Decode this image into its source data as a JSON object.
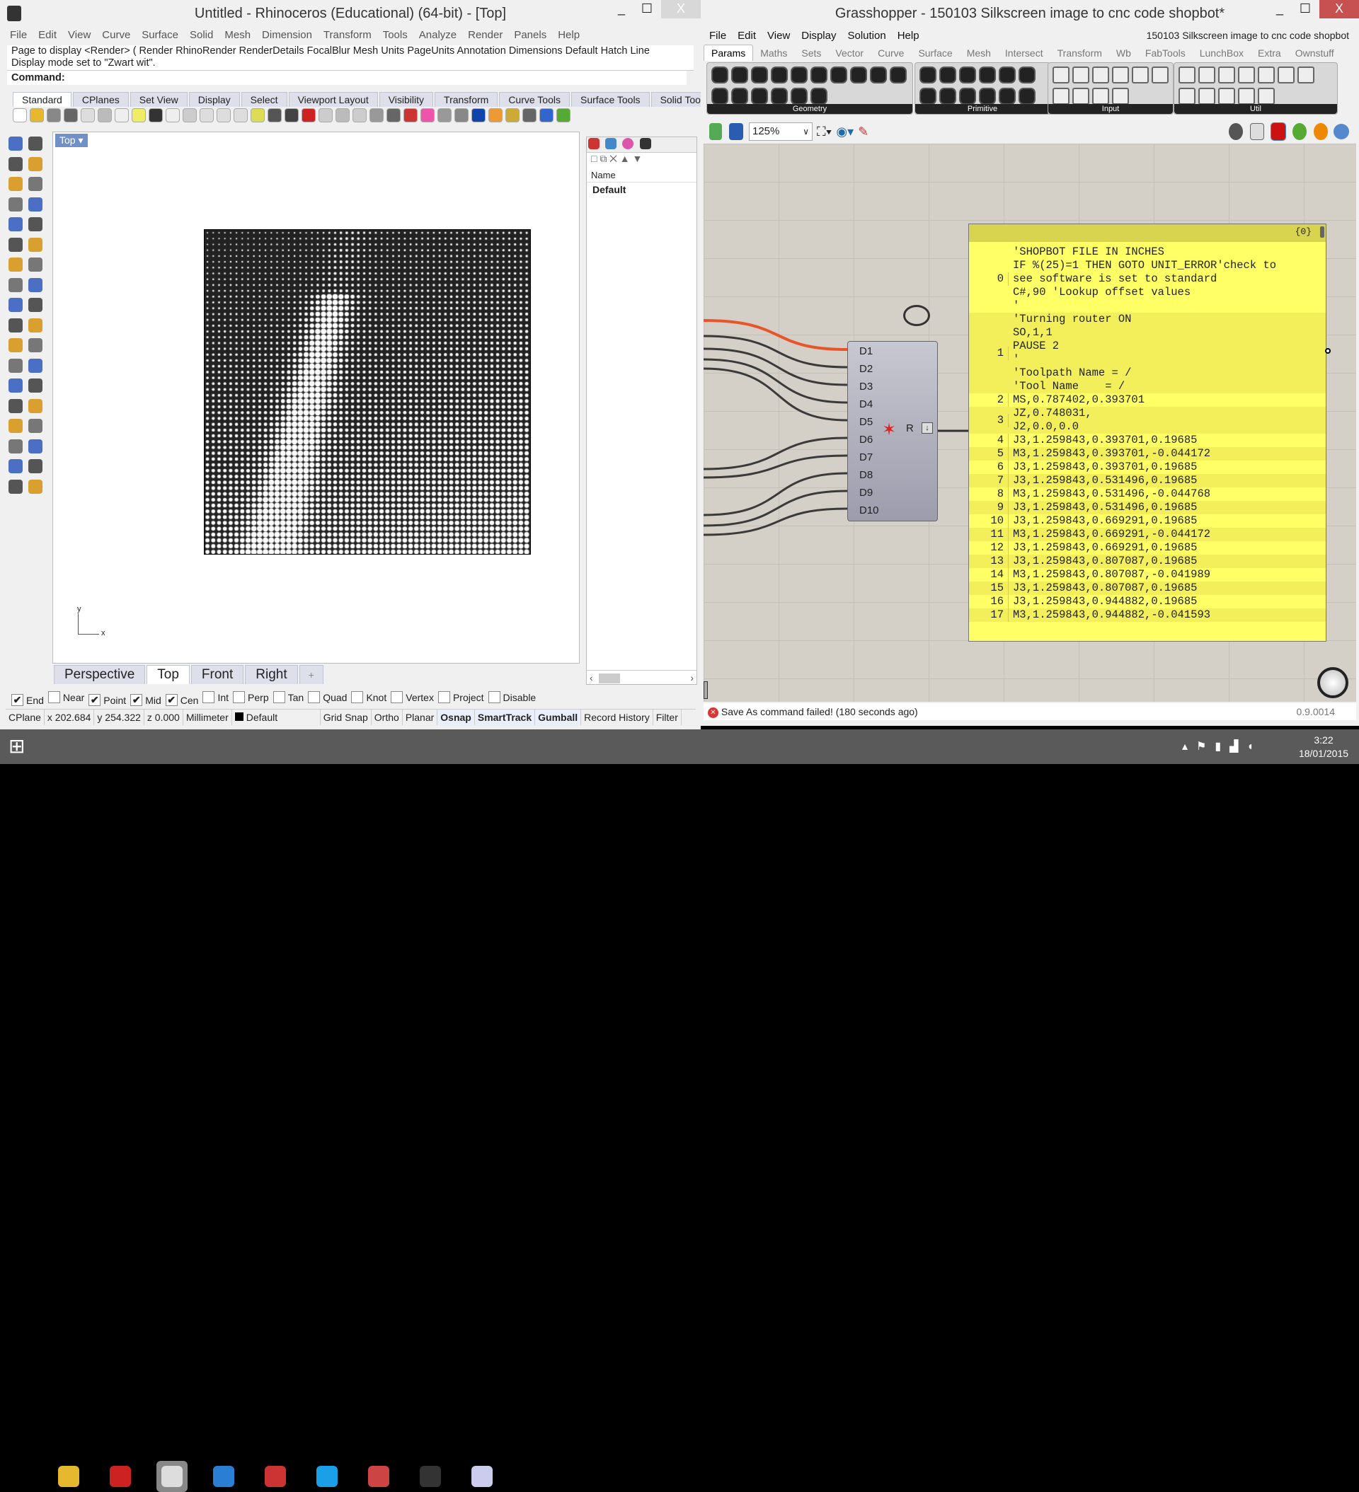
{
  "rhino": {
    "title": "Untitled - Rhinoceros (Educational) (64-bit) - [Top]",
    "window_controls": {
      "minimize": "_",
      "maximize": "☐",
      "close": "X"
    },
    "menu": [
      "File",
      "Edit",
      "View",
      "Curve",
      "Surface",
      "Solid",
      "Mesh",
      "Dimension",
      "Transform",
      "Tools",
      "Analyze",
      "Render",
      "Panels",
      "Help"
    ],
    "history": [
      "Page to display <Render> ( Render  RhinoRender  RenderDetails  FocalBlur  Mesh  Units  PageUnits  Annotation  Dimensions  Default  Hatch  Line",
      "Display mode set to \"Zwart wit\"."
    ],
    "command_label": "Command:",
    "toolbar_tabs": [
      "Standard",
      "CPlanes",
      "Set View",
      "Display",
      "Select",
      "Viewport Layout",
      "Visibility",
      "Transform",
      "Curve Tools",
      "Surface Tools",
      "Solid Tools"
    ],
    "toolbar_more": "»",
    "viewport": {
      "label": "Top",
      "axis_x": "x",
      "axis_y": "y"
    },
    "viewport_tabs": [
      "Perspective",
      "Top",
      "Front",
      "Right"
    ],
    "viewport_tab_add": "+",
    "active_viewport_tab": "Top",
    "layers": {
      "header": "Name",
      "items": [
        "Default"
      ]
    },
    "osnaps": [
      {
        "label": "End",
        "checked": true
      },
      {
        "label": "Near",
        "checked": false
      },
      {
        "label": "Point",
        "checked": true
      },
      {
        "label": "Mid",
        "checked": true
      },
      {
        "label": "Cen",
        "checked": true
      },
      {
        "label": "Int",
        "checked": false
      },
      {
        "label": "Perp",
        "checked": false
      },
      {
        "label": "Tan",
        "checked": false
      },
      {
        "label": "Quad",
        "checked": false
      },
      {
        "label": "Knot",
        "checked": false
      },
      {
        "label": "Vertex",
        "checked": false
      },
      {
        "label": "Project",
        "checked": false
      },
      {
        "label": "Disable",
        "checked": false
      }
    ],
    "status": {
      "cplane": "CPlane",
      "x": "x 202.684",
      "y": "y 254.322",
      "z": "z 0.000",
      "units": "Millimeter",
      "layer": "Default",
      "toggles": [
        {
          "label": "Grid Snap",
          "on": false
        },
        {
          "label": "Ortho",
          "on": false
        },
        {
          "label": "Planar",
          "on": false
        },
        {
          "label": "Osnap",
          "on": true
        },
        {
          "label": "SmartTrack",
          "on": true
        },
        {
          "label": "Gumball",
          "on": true
        },
        {
          "label": "Record History",
          "on": false
        },
        {
          "label": "Filter",
          "on": false
        }
      ]
    }
  },
  "grasshopper": {
    "title": "Grasshopper - 150103 Silkscreen image to cnc code shopbot*",
    "window_controls": {
      "minimize": "_",
      "maximize": "☐",
      "close": "X"
    },
    "menu": [
      "File",
      "Edit",
      "View",
      "Display",
      "Solution",
      "Help"
    ],
    "document_name": "150103 Silkscreen image to cnc code shopbot",
    "tabs": [
      "Params",
      "Maths",
      "Sets",
      "Vector",
      "Curve",
      "Surface",
      "Mesh",
      "Intersect",
      "Transform",
      "Wb",
      "FabTools",
      "LunchBox",
      "Extra",
      "Ownstuff"
    ],
    "active_tab": "Params",
    "ribbon_groups": [
      "Geometry",
      "Primitive",
      "Input",
      "Util"
    ],
    "zoom": "125%",
    "component": {
      "inputs": [
        "D1",
        "D2",
        "D3",
        "D4",
        "D5",
        "D6",
        "D7",
        "D8",
        "D9",
        "D10"
      ],
      "output": "R"
    },
    "panel": {
      "path": "{0}",
      "rows": [
        {
          "index": "0",
          "text": "'SHOPBOT FILE IN INCHES\nIF %(25)=1 THEN GOTO UNIT_ERROR'check to\nsee software is set to standard\nC#,90 'Lookup offset values\n'"
        },
        {
          "index": "1",
          "text": "'Turning router ON\nSO,1,1\nPAUSE 2\n'\n'Toolpath Name = /\n'Tool Name    = /"
        },
        {
          "index": "2",
          "text": "MS,0.787402,0.393701"
        },
        {
          "index": "3",
          "text": "JZ,0.748031,\nJ2,0.0,0.0"
        },
        {
          "index": "4",
          "text": "J3,1.259843,0.393701,0.19685"
        },
        {
          "index": "5",
          "text": "M3,1.259843,0.393701,-0.044172"
        },
        {
          "index": "6",
          "text": "J3,1.259843,0.393701,0.19685"
        },
        {
          "index": "7",
          "text": "J3,1.259843,0.531496,0.19685"
        },
        {
          "index": "8",
          "text": "M3,1.259843,0.531496,-0.044768"
        },
        {
          "index": "9",
          "text": "J3,1.259843,0.531496,0.19685"
        },
        {
          "index": "10",
          "text": "J3,1.259843,0.669291,0.19685"
        },
        {
          "index": "11",
          "text": "M3,1.259843,0.669291,-0.044172"
        },
        {
          "index": "12",
          "text": "J3,1.259843,0.669291,0.19685"
        },
        {
          "index": "13",
          "text": "J3,1.259843,0.807087,0.19685"
        },
        {
          "index": "14",
          "text": "M3,1.259843,0.807087,-0.041989"
        },
        {
          "index": "15",
          "text": "J3,1.259843,0.807087,0.19685"
        },
        {
          "index": "16",
          "text": "J3,1.259843,0.944882,0.19685"
        },
        {
          "index": "17",
          "text": "M3,1.259843,0.944882,-0.041593"
        }
      ]
    },
    "status_message": "Save As command failed! (180 seconds ago)",
    "version": "0.9.0014"
  },
  "taskbar": {
    "apps": [
      "file-explorer",
      "solidworks",
      "rhino",
      "app-blue-ring",
      "app-red-feather",
      "app-c",
      "app-red-gem",
      "app-inkscape",
      "app-paint"
    ],
    "time": "3:22",
    "date": "18/01/2015"
  },
  "colors": {
    "panel_yellow": "#ffff66",
    "wire_selected": "#e8552a",
    "canvas": "#d4d0c8",
    "taskbar": "#5a5a5a"
  }
}
